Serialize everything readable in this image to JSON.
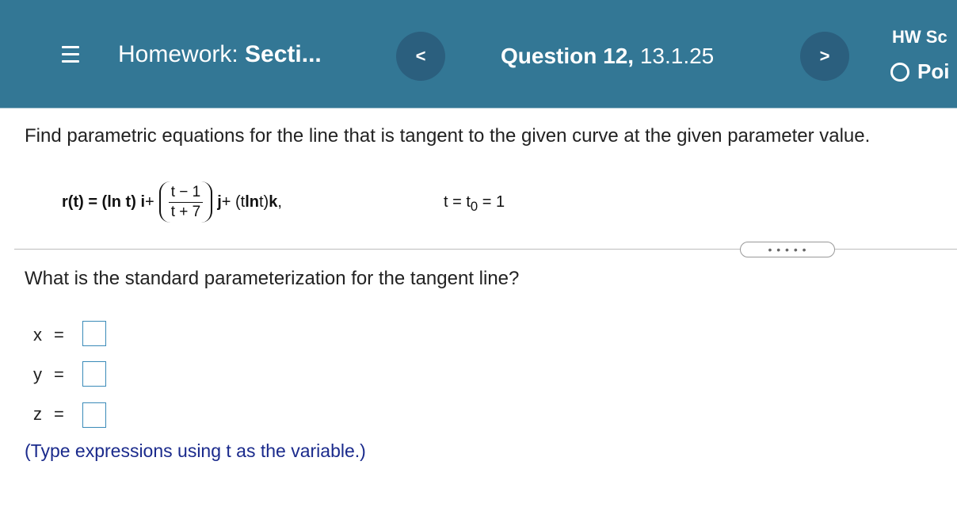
{
  "header": {
    "menu_icon": "hamburger-menu-icon",
    "homework_prefix": "Homework: ",
    "homework_section": "Secti...",
    "prev_label": "<",
    "question_bold": "Question 12,",
    "question_number": " 13.1.25",
    "next_label": ">",
    "hw_score_label": "HW Sc",
    "points_label": "Poi",
    "points_icon": "circle-outline-icon"
  },
  "problem": {
    "prompt": "Find parametric equations for the line that is tangent to the given curve at the given parameter value.",
    "equation": {
      "lhs": "r(t) = (ln t) ",
      "i_bold": "i",
      "plus1": " + ",
      "frac_num": "t − 1",
      "frac_den": "t + 7",
      "j_bold": "j",
      "middle": " + (t ",
      "ln_bold": "ln",
      "tail": " t) ",
      "k_bold": "k",
      "comma": ","
    },
    "param_value": {
      "prefix": "t = t",
      "subscript": "0",
      "suffix": " = 1"
    },
    "more_button": "• • • • •",
    "question": "What is the standard parameterization for the tangent line?",
    "answers": [
      {
        "var": "x",
        "value": ""
      },
      {
        "var": "y",
        "value": ""
      },
      {
        "var": "z",
        "value": ""
      }
    ],
    "equals": "=",
    "hint": "(Type expressions using t as the variable.)"
  }
}
